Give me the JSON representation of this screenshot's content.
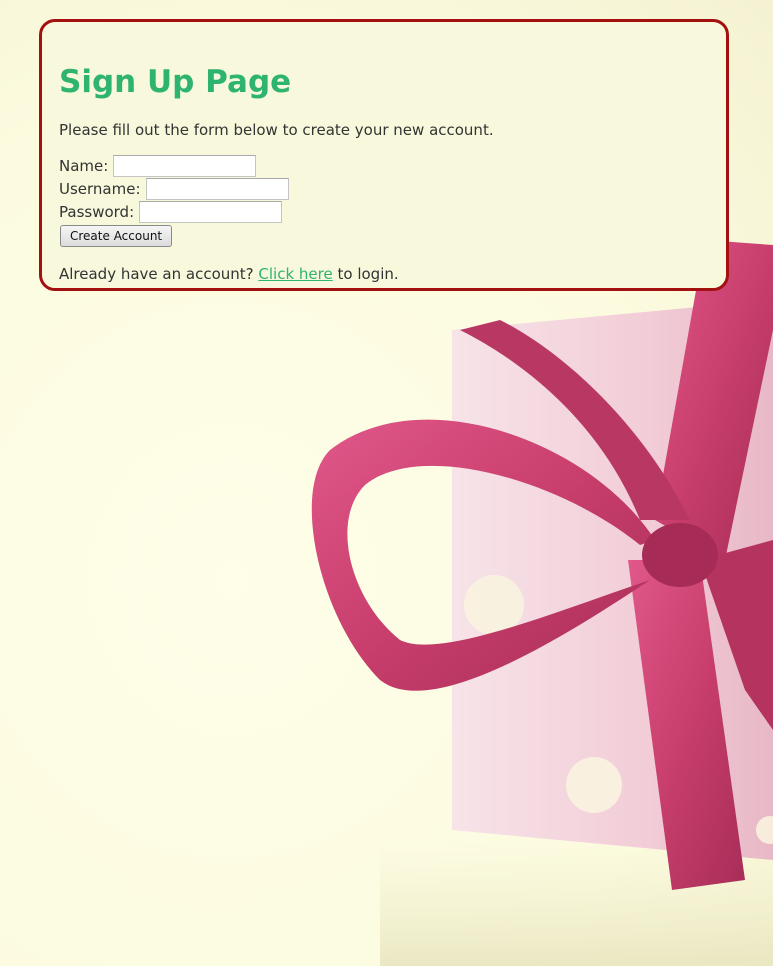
{
  "page": {
    "title": "Sign Up Page",
    "intro": "Please fill out the form below to create your new account."
  },
  "form": {
    "name_label": "Name:",
    "name_value": "",
    "username_label": "Username:",
    "username_value": "",
    "password_label": "Password:",
    "password_value": "",
    "submit_label": "Create Account"
  },
  "footer": {
    "prefix": "Already have an account?",
    "link": "Click here",
    "suffix": "to login."
  },
  "colors": {
    "panel_bg": "#f8f8dc",
    "panel_border": "#a31010",
    "heading": "#2eb46e",
    "link": "#2eb46e",
    "ribbon": "#c8406e",
    "box": "#f5d8e0"
  },
  "background": {
    "image": "gift-box-with-pink-ribbon"
  }
}
